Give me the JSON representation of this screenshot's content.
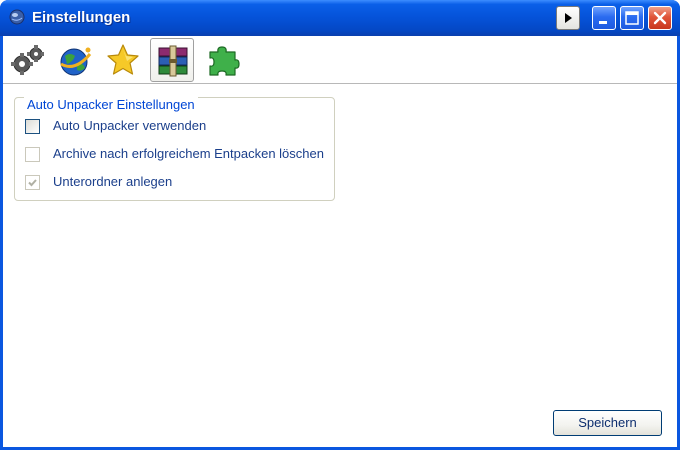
{
  "window": {
    "title": "Einstellungen",
    "icons": {
      "app": "globe-icon",
      "titlebar_buttons": [
        "play-icon",
        "minimize-icon",
        "maximize-icon",
        "close-icon"
      ]
    }
  },
  "toolbar": {
    "items": [
      {
        "id": "general",
        "icon": "gears-icon",
        "selected": false
      },
      {
        "id": "network",
        "icon": "globe-satellite-icon",
        "selected": false
      },
      {
        "id": "favorites",
        "icon": "star-icon",
        "selected": false
      },
      {
        "id": "unpacker",
        "icon": "winrar-books-icon",
        "selected": true
      },
      {
        "id": "plugins",
        "icon": "puzzle-icon",
        "selected": false
      }
    ]
  },
  "auto_unpacker": {
    "legend": "Auto Unpacker Einstellungen",
    "options": [
      {
        "label": "Auto Unpacker verwenden",
        "checked": false,
        "enabled": true
      },
      {
        "label": "Archive nach erfolgreichem Entpacken löschen",
        "checked": false,
        "enabled": false
      },
      {
        "label": "Unterordner anlegen",
        "checked": true,
        "enabled": false
      }
    ]
  },
  "footer": {
    "save_label": "Speichern"
  },
  "colors": {
    "titlebar": "#0552d8",
    "label_text": "#1b3f8b",
    "legend_text": "#0046d5",
    "close_button": "#e0553a"
  }
}
